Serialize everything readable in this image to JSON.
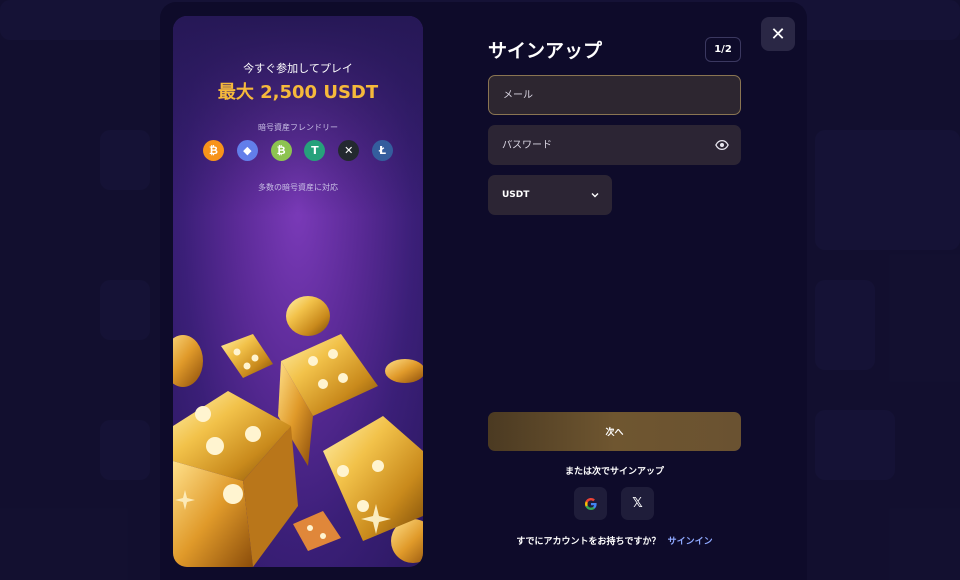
{
  "promo": {
    "join_text": "今すぐ参加してプレイ",
    "amount": "最大 2,500 USDT",
    "friendly_text": "暗号資産フレンドリー",
    "multi_text": "多数の暗号資産に対応",
    "coins": [
      {
        "icon": "bitcoin-icon",
        "glyph": "₿",
        "color": "#f7931a"
      },
      {
        "icon": "ethereum-icon",
        "glyph": "◆",
        "color": "#627eea"
      },
      {
        "icon": "bitcoin-cash-icon",
        "glyph": "₿",
        "color": "#8dc351"
      },
      {
        "icon": "tether-icon",
        "glyph": "T",
        "color": "#26a17b"
      },
      {
        "icon": "xrp-icon",
        "glyph": "✕",
        "color": "#23292f"
      },
      {
        "icon": "litecoin-icon",
        "glyph": "Ł",
        "color": "#345d9d"
      }
    ]
  },
  "form": {
    "title": "サインアップ",
    "step": "1/2",
    "email_placeholder": "メール",
    "password_placeholder": "パスワード",
    "currency": "USDT",
    "next_label": "次へ",
    "or_text": "または次でサインアップ",
    "has_account_text": "すでにアカウントをお持ちですか？",
    "signin_label": "サインイン",
    "close_icon": "close-icon"
  },
  "colors": {
    "accent_gold": "#f6b93b",
    "link": "#8fa9ff",
    "modal_bg": "#0e0b2a"
  }
}
